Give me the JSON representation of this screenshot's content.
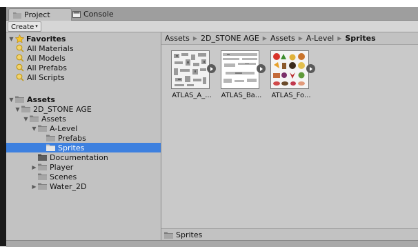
{
  "tabs": [
    {
      "label": "Project",
      "icon": "folder-icon",
      "active": true
    },
    {
      "label": "Console",
      "icon": "console-icon",
      "active": false
    }
  ],
  "toolbar": {
    "create_label": "Create",
    "create_caret": "▾"
  },
  "tree": {
    "favorites": {
      "label": "Favorites",
      "items": [
        "All Materials",
        "All Models",
        "All Prefabs",
        "All Scripts"
      ]
    },
    "assets": {
      "label": "Assets",
      "items": [
        {
          "label": "2D_STONE AGE",
          "depth": 1,
          "expanded": true
        },
        {
          "label": "Assets",
          "depth": 2,
          "expanded": true
        },
        {
          "label": "A-Level",
          "depth": 3,
          "expanded": true
        },
        {
          "label": "Prefabs",
          "depth": 4
        },
        {
          "label": "Sprites",
          "depth": 4,
          "selected": true
        },
        {
          "label": "Documentation",
          "depth": 3
        },
        {
          "label": "Player",
          "depth": 3,
          "expanded": false
        },
        {
          "label": "Scenes",
          "depth": 3
        },
        {
          "label": "Water_2D",
          "depth": 3,
          "expanded": false
        }
      ]
    }
  },
  "breadcrumb": [
    "Assets",
    "2D_STONE AGE",
    "Assets",
    "A-Level",
    "Sprites"
  ],
  "assets": [
    {
      "label": "ATLAS_A_..."
    },
    {
      "label": "ATLAS_Ba..."
    },
    {
      "label": "ATLAS_Fo..."
    }
  ],
  "pathbar": {
    "label": "Sprites"
  },
  "colors": {
    "selection": "#3d80df",
    "panel": "#c2c2c2",
    "folder": "#8e8e8e",
    "star": "#f5c32b"
  }
}
